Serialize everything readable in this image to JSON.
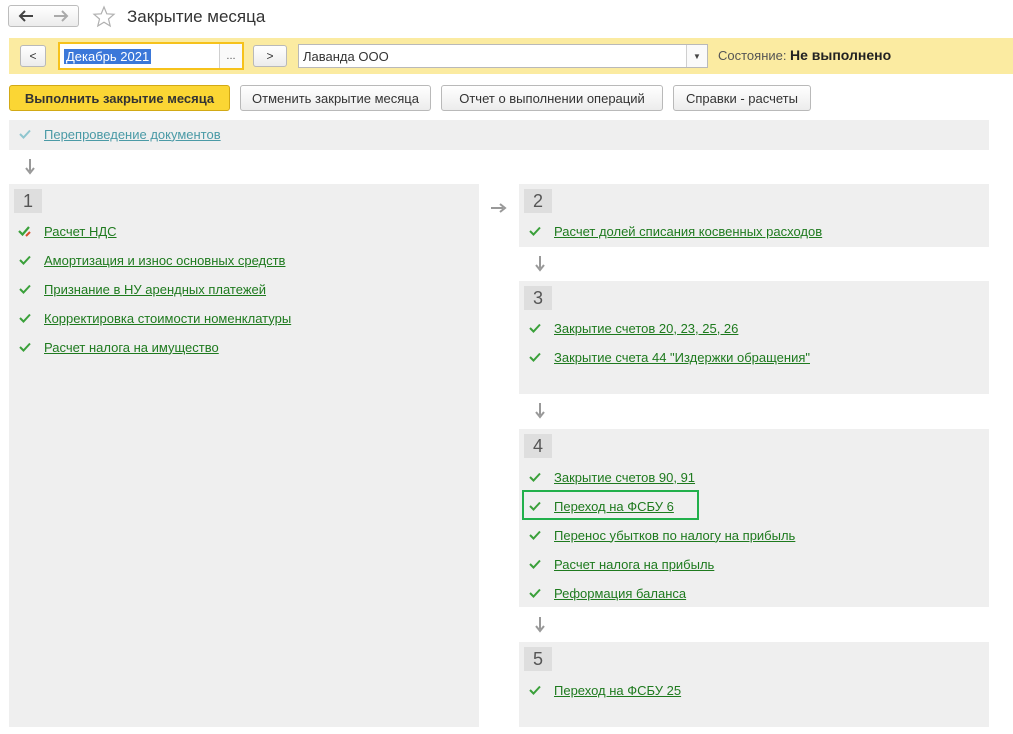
{
  "window": {
    "title": "Закрытие месяца",
    "back_icon": "back-arrow-icon",
    "forward_icon": "forward-arrow-icon",
    "favorite_icon": "star-icon"
  },
  "toolbar": {
    "prev_label": "<",
    "next_label": ">",
    "period_value": "Декабрь 2021",
    "period_select_label": "...",
    "organization_value": "Лаванда ООО",
    "state_label": "Состояние:",
    "state_value": "Не выполнено"
  },
  "actions": {
    "execute": "Выполнить закрытие месяца",
    "cancel": "Отменить закрытие месяца",
    "report": "Отчет о выполнении операций",
    "references": "Справки - расчеты"
  },
  "pre_step": {
    "label": "Перепроведение документов"
  },
  "stages": [
    {
      "number": "1",
      "items": [
        "Расчет НДС",
        "Амортизация и износ основных средств",
        "Признание в НУ арендных платежей",
        "Корректировка стоимости номенклатуры",
        "Расчет налога на имущество"
      ]
    },
    {
      "number": "2",
      "items": [
        "Расчет долей списания косвенных расходов"
      ]
    },
    {
      "number": "3",
      "items": [
        "Закрытие счетов 20, 23, 25, 26",
        "Закрытие счета 44 \"Издержки обращения\""
      ]
    },
    {
      "number": "4",
      "items": [
        "Закрытие счетов 90, 91",
        "Переход на ФСБУ 6",
        "Перенос убытков по налогу на прибыль",
        "Расчет налога на прибыль",
        "Реформация баланса"
      ]
    },
    {
      "number": "5",
      "items": [
        "Переход на ФСБУ 25"
      ]
    }
  ],
  "colors": {
    "toolbar_bg": "#fbeba1",
    "primary_button": "#fbd634",
    "link_green": "#1e7a1e",
    "check_green": "#3aa03a",
    "highlight": "#22b04b",
    "panel_bg": "#efefef"
  }
}
